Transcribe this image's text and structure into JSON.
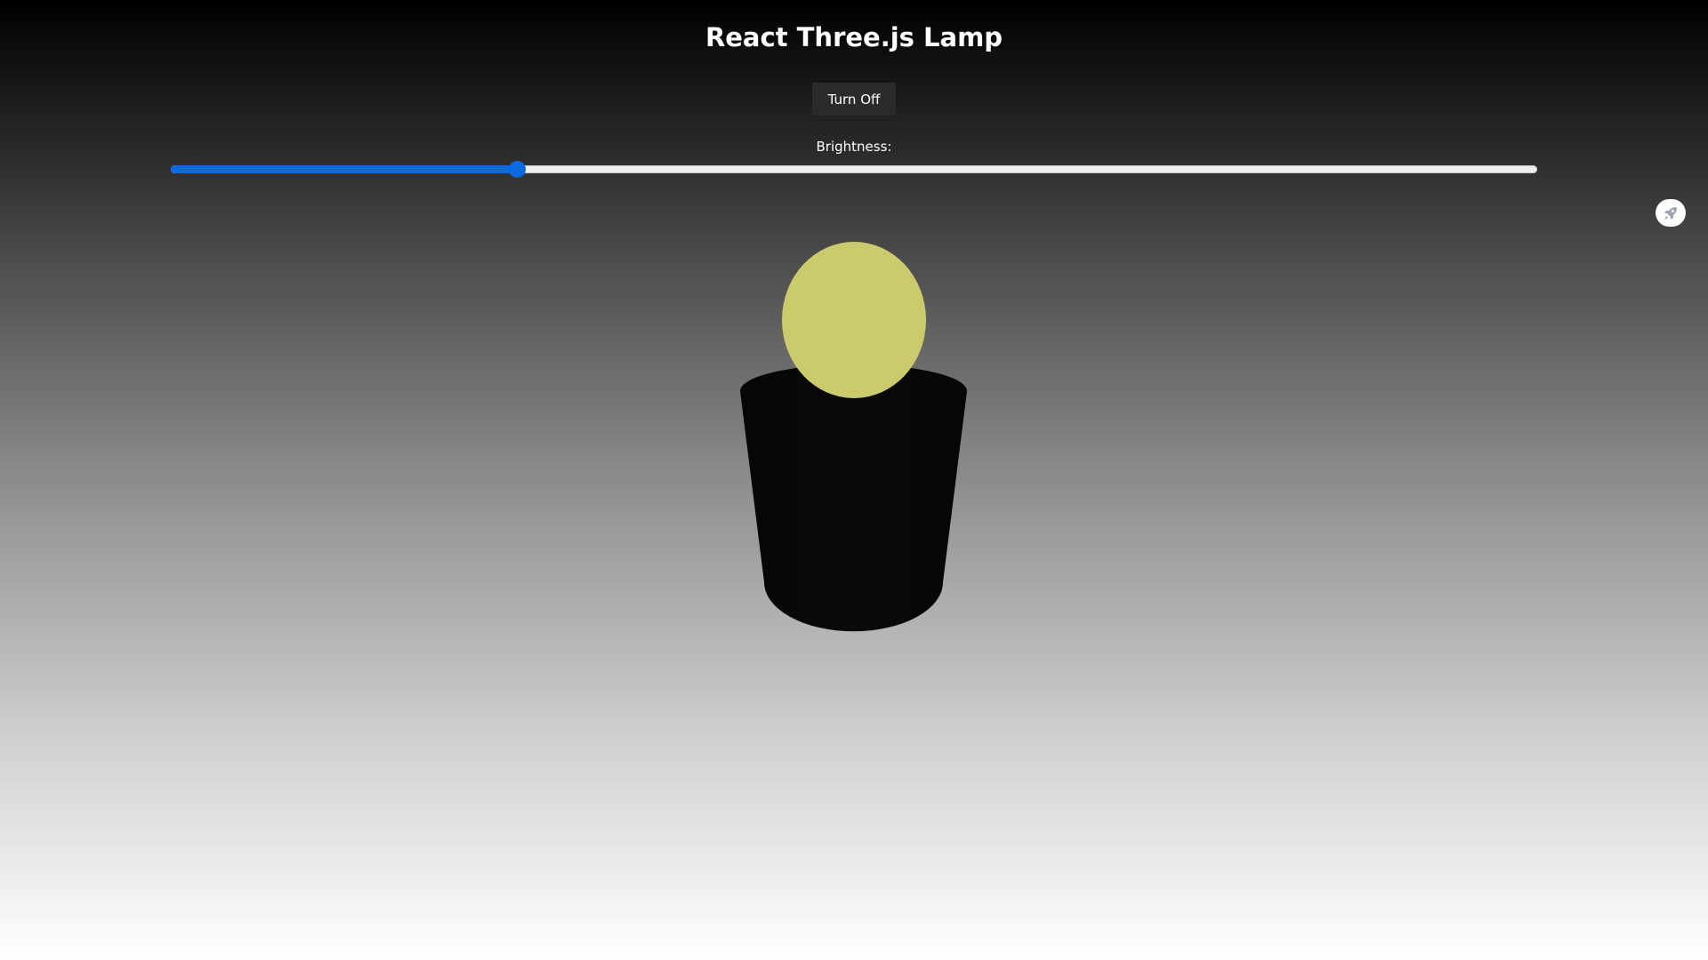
{
  "app": {
    "title": "React Three.js Lamp"
  },
  "controls": {
    "toggle_label": "Turn Off",
    "brightness_label": "Brightness:",
    "brightness_fraction": 0.253,
    "slider_color": "#0b69e2"
  },
  "scene": {
    "bulb_color": "#cbcb6e",
    "shade_color": "#070707",
    "background_top": "#000000",
    "background_bottom": "#ffffff"
  },
  "side_widget": {
    "icon": "rocket-icon"
  }
}
